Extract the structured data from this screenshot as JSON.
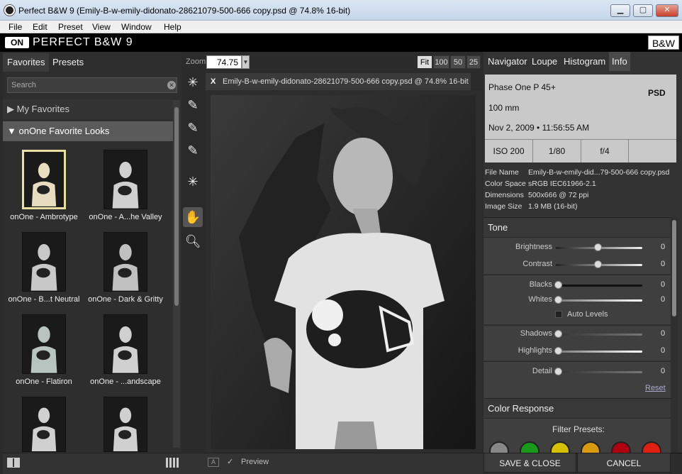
{
  "window": {
    "title": "Perfect B&W 9 (Emily-B-w-emily-didonato-28621079-500-666 copy.psd @ 74.8% 16-bit)",
    "controls": [
      "minimize",
      "maximize",
      "close"
    ]
  },
  "menu": [
    "File",
    "Edit",
    "Preset",
    "View",
    "Window",
    "Help"
  ],
  "app": {
    "logo": "ON",
    "name": "PERFECT B&W 9",
    "mode_badge": "B&W"
  },
  "left_panel": {
    "tabs": [
      "Favorites",
      "Presets"
    ],
    "search_placeholder": "Search",
    "categories": [
      "My Favorites",
      "onOne Favorite Looks"
    ],
    "thumbnails": [
      {
        "label": "onOne - Ambrotype"
      },
      {
        "label": "onOne - A...he Valley"
      },
      {
        "label": "onOne - B...t Neutral"
      },
      {
        "label": "onOne - Dark & Gritty"
      },
      {
        "label": "onOne - Flatiron"
      },
      {
        "label": "onOne - ...andscape"
      },
      {
        "label": ""
      },
      {
        "label": ""
      }
    ]
  },
  "viewer": {
    "zoom_label": "Zoom",
    "zoom_value": "74.75",
    "zoom_buttons": [
      "Fit",
      "100",
      "50",
      "25"
    ],
    "doc_tab_close": "X",
    "doc_tab": "Emily-B-w-emily-didonato-28621079-500-666 copy.psd @ 74.8% 16-bit",
    "footer_a": "A",
    "preview_check": "✓",
    "preview_label": "Preview"
  },
  "right_panel": {
    "tabs": [
      "Navigator",
      "Loupe",
      "Histogram",
      "Info"
    ],
    "info": {
      "camera": "Phase One P 45+",
      "lens": "100 mm",
      "date": "Nov 2, 2009 • 11:56:55 AM",
      "format": "PSD",
      "iso": "ISO 200",
      "shutter": "1/80",
      "aperture": "f/4"
    },
    "meta": [
      {
        "key": "File Name",
        "value": "Emily-B-w-emily-did...79-500-666 copy.psd"
      },
      {
        "key": "Color Space",
        "value": "sRGB IEC61966-2.1"
      },
      {
        "key": "Dimensions",
        "value": "500x666 @ 72 ppi"
      },
      {
        "key": "Image Size",
        "value": "1.9 MB (16-bit)"
      }
    ],
    "tone": {
      "title": "Tone",
      "sliders": [
        {
          "label": "Brightness",
          "value": "0",
          "level": 0.5
        },
        {
          "label": "Contrast",
          "value": "0",
          "level": 0.5
        },
        {
          "label": "Blacks",
          "value": "0",
          "level": 0.0
        },
        {
          "label": "Whites",
          "value": "0",
          "level": 0.0
        },
        {
          "label": "Shadows",
          "value": "0",
          "level": 0.0
        },
        {
          "label": "Highlights",
          "value": "0",
          "level": 0.0
        },
        {
          "label": "Detail",
          "value": "0",
          "level": 0.0
        }
      ],
      "auto_levels": "Auto Levels",
      "reset": "Reset"
    },
    "color_response": {
      "title": "Color Response",
      "filter_presets_label": "Filter Presets:",
      "filters": [
        "#888888",
        "#1a9a1a",
        "#d6c000",
        "#d99a10",
        "#b00010",
        "#e02010"
      ]
    },
    "buttons": {
      "save": "SAVE & CLOSE",
      "cancel": "CANCEL"
    }
  }
}
